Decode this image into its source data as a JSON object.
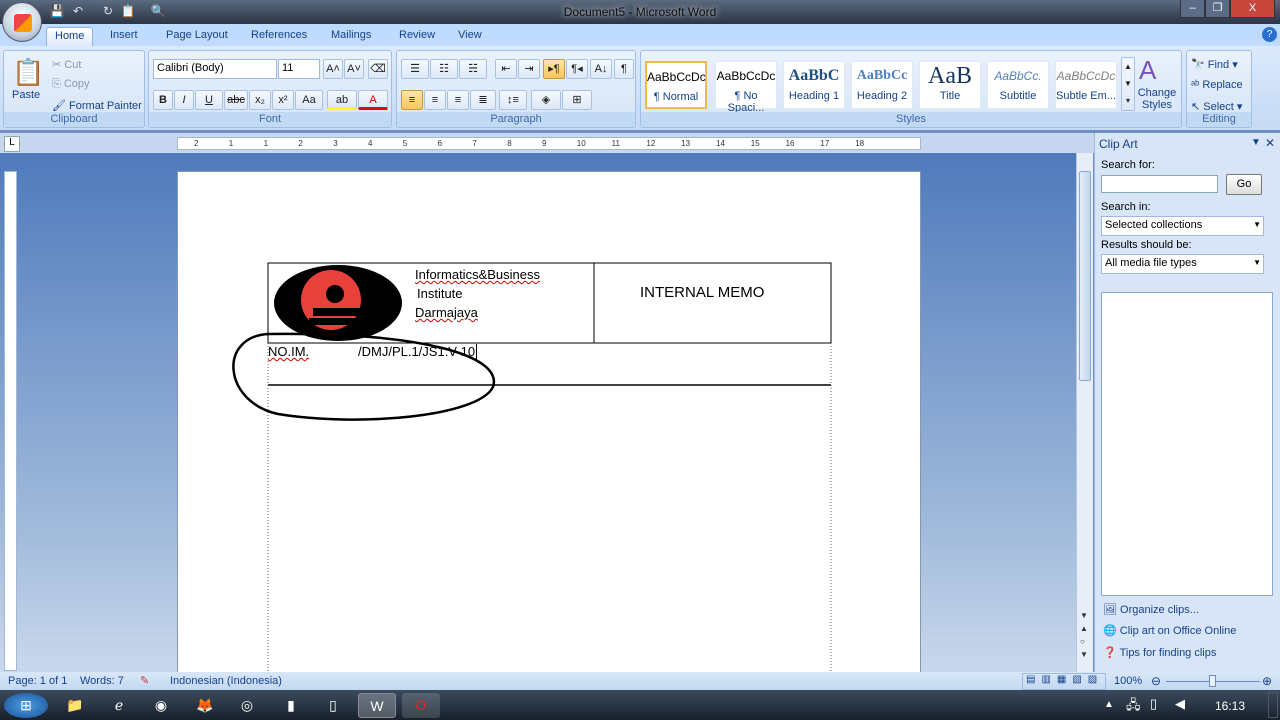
{
  "window": {
    "title": "Document5 - Microsoft Word",
    "minimize": "–",
    "restore": "❐",
    "close": "X"
  },
  "tabs": [
    "Home",
    "Insert",
    "Page Layout",
    "References",
    "Mailings",
    "Review",
    "View"
  ],
  "clipboard": {
    "paste": "Paste",
    "cut": "Cut",
    "copy": "Copy",
    "format_painter": "Format Painter",
    "label": "Clipboard"
  },
  "font": {
    "name": "Calibri (Body)",
    "size": "11",
    "label": "Font",
    "bold": "B",
    "italic": "I",
    "underline": "U",
    "strike": "abc",
    "sub": "x₂",
    "sup": "x²",
    "case": "Aa",
    "grow": "A˄",
    "shrink": "A˅"
  },
  "paragraph": {
    "label": "Paragraph",
    "pilcrow": "¶"
  },
  "styles": {
    "label": "Styles",
    "items": [
      {
        "preview": "AaBbCcDc",
        "name": "¶ Normal"
      },
      {
        "preview": "AaBbCcDc",
        "name": "¶ No Spaci..."
      },
      {
        "preview": "AaBbC",
        "name": "Heading 1"
      },
      {
        "preview": "AaBbCc",
        "name": "Heading 2"
      },
      {
        "preview": "AaB",
        "name": "Title"
      },
      {
        "preview": "AaBbCc.",
        "name": "Subtitle"
      },
      {
        "preview": "AaBbCcDc",
        "name": "Subtle Em..."
      }
    ],
    "change_styles": "Change Styles"
  },
  "editing": {
    "label": "Editing",
    "find": "Find",
    "replace": "Replace",
    "select": "Select"
  },
  "ruler": {
    "marks": [
      "2",
      "1",
      "1",
      "2",
      "3",
      "4",
      "5",
      "6",
      "7",
      "8",
      "9",
      "10",
      "11",
      "12",
      "13",
      "14",
      "15",
      "16",
      "17",
      "18"
    ]
  },
  "document": {
    "institute_lines": [
      "Informatics&Business",
      "Institute",
      "Darmajaya"
    ],
    "memo_title": "INTERNAL MEMO",
    "memo_number_prefix": "NO.IM.",
    "memo_number_suffix": "/DMJ/PL.1/JS1.V-10",
    "logo_colors": {
      "outer": "#000000",
      "inner": "#e8413c"
    }
  },
  "clipart": {
    "title": "Clip Art",
    "search_for": "Search for:",
    "search_value": "",
    "go": "Go",
    "search_in": "Search in:",
    "search_in_value": "Selected collections",
    "results_label": "Results should be:",
    "results_value": "All media file types",
    "links": [
      "Organize clips...",
      "Clip art on Office Online",
      "Tips for finding clips"
    ]
  },
  "status": {
    "page": "Page: 1 of 1",
    "words": "Words: 7",
    "language": "Indonesian (Indonesia)",
    "zoom": "100%",
    "zoom_percent": 100
  },
  "taskbar": {
    "time": "16:13"
  }
}
